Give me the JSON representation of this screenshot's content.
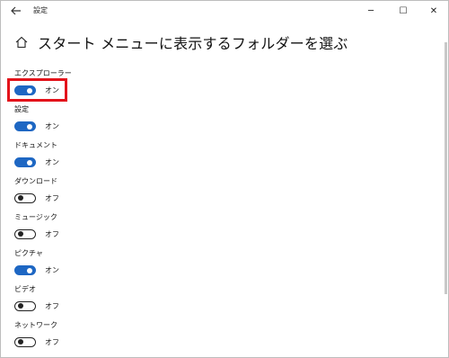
{
  "window": {
    "title": "設定",
    "back_icon": "back-arrow-icon",
    "controls": {
      "minimize": "─",
      "maximize": "☐",
      "close": "✕"
    }
  },
  "page": {
    "title": "スタート メニューに表示するフォルダーを選ぶ",
    "home_icon": "home-icon"
  },
  "folders": [
    {
      "label": "エクスプローラー",
      "state": "オン",
      "on": true
    },
    {
      "label": "設定",
      "state": "オン",
      "on": true
    },
    {
      "label": "ドキュメント",
      "state": "オン",
      "on": true
    },
    {
      "label": "ダウンロード",
      "state": "オフ",
      "on": false
    },
    {
      "label": "ミュージック",
      "state": "オフ",
      "on": false
    },
    {
      "label": "ピクチャ",
      "state": "オン",
      "on": true
    },
    {
      "label": "ビデオ",
      "state": "オフ",
      "on": false
    },
    {
      "label": "ネットワーク",
      "state": "オフ",
      "on": false
    }
  ],
  "colors": {
    "accent": "#1e67c3",
    "highlight": "#e3131b"
  }
}
